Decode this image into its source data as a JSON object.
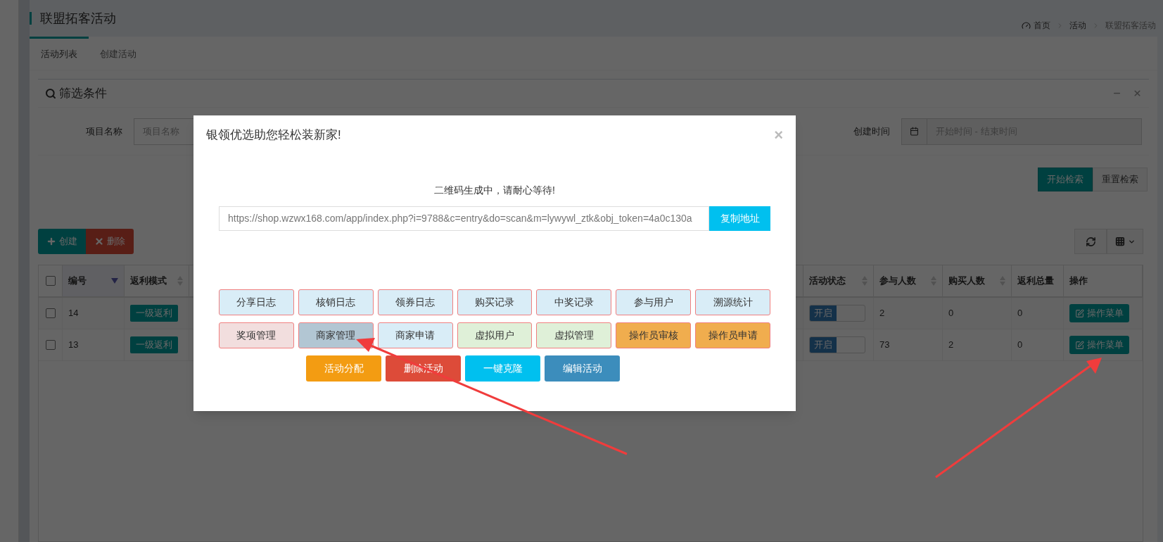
{
  "page": {
    "title": "联盟拓客活动"
  },
  "breadcrumb": [
    "首页",
    "活动",
    "联盟拓客活动"
  ],
  "tabs": [
    {
      "label": "活动列表",
      "selected": true
    },
    {
      "label": "创建活动",
      "selected": false
    }
  ],
  "filter": {
    "title": "筛选条件",
    "fields": [
      {
        "label": "项目名称",
        "placeholder": "项目名称",
        "kind": "text"
      },
      {
        "label": "创建时间",
        "placeholder": "开始时间 - 结束时间",
        "kind": "date"
      }
    ],
    "buttons": [
      {
        "label": "开始检索",
        "kind": "primary"
      },
      {
        "label": "重置检索",
        "kind": "default"
      }
    ]
  },
  "toolbar": [
    {
      "label": "创建",
      "kind": "create"
    },
    {
      "label": "删除",
      "kind": "delete"
    }
  ],
  "table": {
    "all_checked": false,
    "columns": [
      {
        "label": "编号",
        "sortable": true,
        "sorted": true
      },
      {
        "label": "返利模式",
        "sortable": true,
        "sorted": false
      },
      {
        "label": "活动状态",
        "sortable": true,
        "sorted": false
      },
      {
        "label": "参与人数",
        "sortable": true,
        "sorted": false
      },
      {
        "label": "购买人数",
        "sortable": true,
        "sorted": false
      },
      {
        "label": "返利总量",
        "sortable": false,
        "sorted": false
      },
      {
        "label": "操作",
        "sortable": false,
        "sorted": false
      }
    ],
    "rows": [
      {
        "checked": false,
        "id": "14",
        "mode": "一级返利",
        "status": {
          "label": "开启",
          "on": true
        },
        "participants": "2",
        "buyers": "0",
        "rebate_total": "0",
        "action": "操作菜单"
      },
      {
        "checked": false,
        "id": "13",
        "mode": "一级返利",
        "status": {
          "label": "开启",
          "on": true
        },
        "participants": "73",
        "buyers": "2",
        "rebate_total": "0",
        "action": "操作菜单"
      }
    ]
  },
  "modal": {
    "title": "银领优选助您轻松装新家!",
    "close": "×",
    "message": "二维码生成中，请耐心等待!",
    "url": "https://shop.wzwx168.com/app/index.php?i=9788&c=entry&do=scan&m=lywywl_ztk&obj_token=4a0c130a",
    "copy_button": "复制地址",
    "grid_buttons": [
      {
        "label": "分享日志",
        "kind": "info",
        "selected": false
      },
      {
        "label": "核销日志",
        "kind": "info",
        "selected": false
      },
      {
        "label": "领券日志",
        "kind": "info",
        "selected": false
      },
      {
        "label": "购买记录",
        "kind": "info",
        "selected": false
      },
      {
        "label": "中奖记录",
        "kind": "info",
        "selected": false
      },
      {
        "label": "参与用户",
        "kind": "info",
        "selected": false
      },
      {
        "label": "溯源统计",
        "kind": "info",
        "selected": false
      },
      {
        "label": "奖项管理",
        "kind": "danger",
        "selected": false
      },
      {
        "label": "商家管理",
        "kind": "info",
        "selected": true
      },
      {
        "label": "商家申请",
        "kind": "info",
        "selected": false
      },
      {
        "label": "虚拟用户",
        "kind": "success",
        "selected": false
      },
      {
        "label": "虚拟管理",
        "kind": "success",
        "selected": false
      },
      {
        "label": "操作员审核",
        "kind": "warning",
        "selected": false
      },
      {
        "label": "操作员申请",
        "kind": "warning",
        "selected": false
      }
    ],
    "action_buttons": [
      {
        "label": "活动分配",
        "color": "#f39c12"
      },
      {
        "label": "删除活动",
        "color": "#dd4b39"
      },
      {
        "label": "一键克隆",
        "color": "#00c0ef"
      },
      {
        "label": "编辑活动",
        "color": "#3c8dbc"
      }
    ]
  }
}
